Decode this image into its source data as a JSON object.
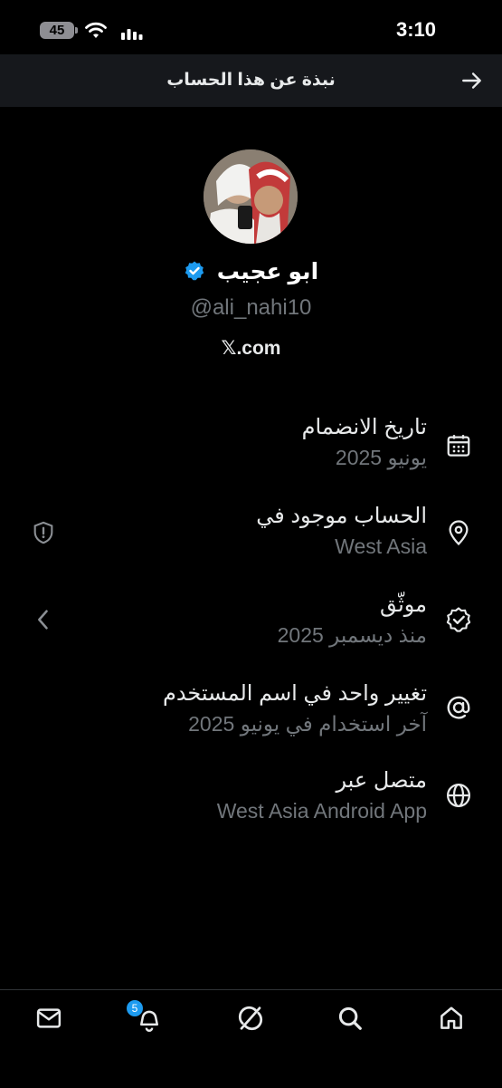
{
  "status_bar": {
    "battery": "45",
    "time": "3:10"
  },
  "header": {
    "title": "نبذة عن هذا الحساب"
  },
  "profile": {
    "display_name": "ابو عجيب",
    "handle": "@ali_nahi10",
    "site": ".com",
    "site_mark": "𝕏"
  },
  "info_rows": [
    {
      "label": "تاريخ الانضمام",
      "value": "يونيو 2025",
      "icon": "calendar-icon"
    },
    {
      "label": "الحساب موجود في",
      "value": "West Asia",
      "icon": "location-pin-icon",
      "side_icon": "shield-alert-icon"
    },
    {
      "label": "موثّق",
      "value": "منذ ديسمبر 2025",
      "icon": "verified-check-icon",
      "side_icon": "chevron-left-icon"
    },
    {
      "label": "تغيير واحد في اسم المستخدم",
      "value": "آخر استخدام في يونيو 2025",
      "icon": "at-sign-icon"
    },
    {
      "label": "متصل عبر",
      "value": "West Asia Android App",
      "icon": "globe-icon"
    }
  ],
  "bottom_nav": {
    "notifications_badge": "5",
    "items": [
      "mail-icon",
      "bell-icon",
      "grok-icon",
      "search-icon",
      "home-icon"
    ]
  },
  "colors": {
    "accent": "#1d9bf0",
    "secondary_text": "#71767b",
    "header_bg": "#16181c"
  }
}
